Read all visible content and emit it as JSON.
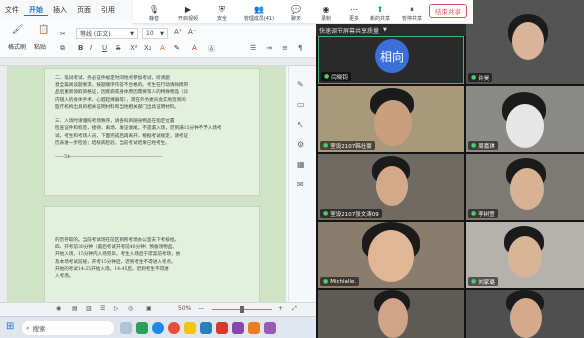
{
  "editor": {
    "menu": [
      "文件",
      "开始",
      "插入",
      "页面",
      "引用"
    ],
    "active_menu": "开始",
    "toolbar": {
      "format_brush": "格式刷",
      "paste": "粘贴",
      "font_name": "等线 (正文)",
      "font_size": "10",
      "bold": "B",
      "italic": "I",
      "underline": "U",
      "strike": "S"
    },
    "page1_text": [
      "二、笔试考试、务必证件规定时间地点参加考试，听清题",
      "意全篇阅读题要求，按题顺序作答不合格的。考生在行动清除携带",
      "品后重新领取资格证，因疾病或身体原因需要等人的特殊物品（诊",
      "内镜入的身体手术、心脏起搏器等），须在外务委员会实地签到的",
      "医疗机构出具的相关证明材料和当地相关部门出具证明材料。",
      "",
      "三、入场时请遵照考场秩序，请各科目随身物品在指定位置",
      "检查证件和标签，接待、离场、发证收尾，不遗漏入场，迟到满15分钟不予入场考",
      "试。考生和考场人员，下面完成后再离开，根据考试规定，请考证",
      "历表进一步检验；结核病检验，当前考试结果已经考生。",
      "",
      "——54————————————————————"
    ],
    "page2_text": [
      "的历存取的。当前考试场在前区到所考场办公室去下考核给。",
      "  四、开考前30分钟（最后考试开考前40分钟）预备领物品。",
      "开始入场，15分钟内入场完毕。考生入场后于席案前考场，依",
      "及本场考试前规，开考15分钟后，迟到考生不得进入考点。",
      "  开始的考试14:25开始入场。14:45后，迟到考生不得进",
      "入考场。"
    ],
    "status": {
      "zoom": "50%",
      "zoom_minus": "—",
      "zoom_plus": "+"
    },
    "taskbar": {
      "search_placeholder": "搜索"
    }
  },
  "meeting": {
    "toolbar": [
      {
        "label": "静音",
        "icon": "mic-icon"
      },
      {
        "label": "开启视频",
        "icon": "video-icon"
      },
      {
        "label": "安全",
        "icon": "shield-icon"
      },
      {
        "label": "管理成员(41)",
        "icon": "people-icon"
      },
      {
        "label": "聊天",
        "icon": "chat-icon"
      },
      {
        "label": "录制",
        "icon": "record-icon"
      },
      {
        "label": "更多",
        "icon": "more-icon"
      },
      {
        "label": "新的共享",
        "icon": "share-icon"
      },
      {
        "label": "暂停共享",
        "icon": "pause-icon"
      }
    ],
    "end_share": "结束共享",
    "voice_banner": "快速调节屏幕共享质量",
    "avatar_text": "相向",
    "participants": [
      {
        "name": "闫晓钧"
      },
      {
        "name": "许昊"
      },
      {
        "name": "室设2107韩壮豪"
      },
      {
        "name": "周嘉琪"
      },
      {
        "name": "室设2107张文涛09"
      },
      {
        "name": "李树萱"
      },
      {
        "name": "Michlalle."
      },
      {
        "name": "刘家璐"
      }
    ]
  },
  "colors": {
    "accent": "#2a6fdb",
    "end_share": "#e05656",
    "mic_on": "#4ad06a",
    "page_green": "#e4f0de"
  }
}
